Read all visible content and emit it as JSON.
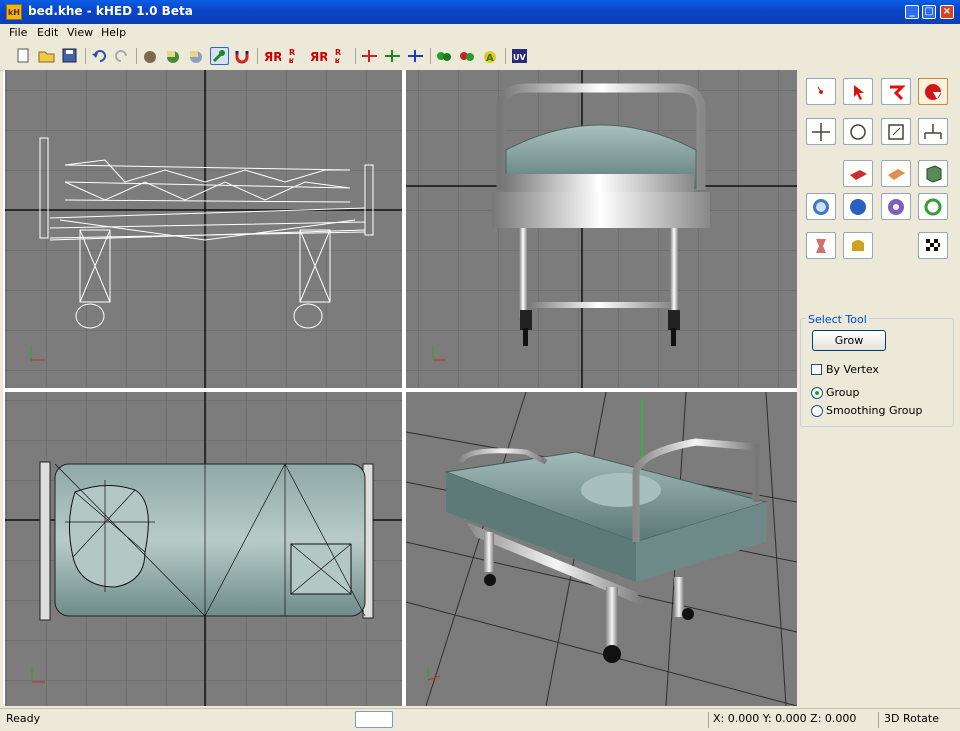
{
  "window": {
    "title": "bed.khe - kHED 1.0 Beta",
    "app_icon_text": "kH"
  },
  "menu": [
    "File",
    "Edit",
    "View",
    "Help"
  ],
  "toolbar_icons": [
    "new-file",
    "open-folder",
    "save",
    "undo",
    "redo",
    "load-model",
    "import",
    "export",
    "tool-wrench",
    "magnet",
    "flip-r-1",
    "flip-r-2",
    "flip-r-3",
    "flip-r-4",
    "mirror-x",
    "mirror-y",
    "mirror-z",
    "green-blobs",
    "red-green-blobs",
    "letter-a",
    "uv-editor"
  ],
  "viewports": [
    {
      "name": "front-view",
      "style": "wireframe"
    },
    {
      "name": "side-view",
      "style": "shaded"
    },
    {
      "name": "top-view",
      "style": "shaded-wire"
    },
    {
      "name": "perspective-view",
      "style": "shaded"
    }
  ],
  "axis_labels": {
    "x": "x",
    "y": "y"
  },
  "tool_panel": {
    "group_title": "Select Tool",
    "grow_button": "Grow",
    "by_vertex": {
      "label": "By Vertex",
      "checked": false
    },
    "radio_group": {
      "label": "Group",
      "selected": true
    },
    "radio_smoothing": {
      "label": "Smoothing Group",
      "selected": false
    }
  },
  "status": {
    "left": "Ready",
    "coords": "X: 0.000 Y: 0.000 Z: 0.000",
    "mode": "3D Rotate"
  },
  "colors": {
    "title_blue": "#0a46c8",
    "viewport_gray": "#7c7c7c",
    "grid": "#666666",
    "mattress": "#6f8e8c",
    "accent": "#316ac5"
  }
}
